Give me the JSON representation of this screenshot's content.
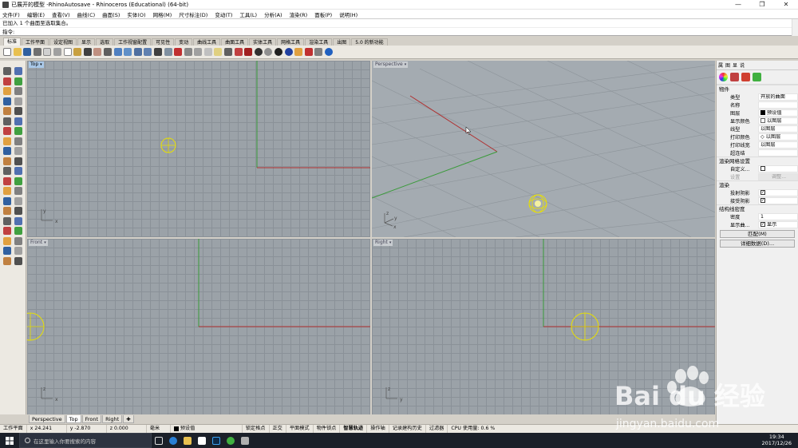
{
  "window": {
    "title": "已展开的模型 -RhinoAutosave - Rhinoceros (Educational) (64-bit)",
    "min_glyph": "—",
    "max_glyph": "❐",
    "close_glyph": "✕"
  },
  "menu": [
    "文件(F)",
    "编辑(E)",
    "查看(V)",
    "曲线(C)",
    "曲面(S)",
    "实体(O)",
    "网格(M)",
    "尺寸标注(D)",
    "变动(T)",
    "工具(L)",
    "分析(A)",
    "渲染(R)",
    "面板(P)",
    "说明(H)"
  ],
  "command": {
    "history": "已加入 1 个曲面至选取集合。",
    "prompt": "指令:"
  },
  "toolbar_tabs": [
    "标准",
    "工作平面",
    "设定视图",
    "显示",
    "选取",
    "工作视窗配置",
    "可见性",
    "变动",
    "曲线工具",
    "曲面工具",
    "实体工具",
    "网格工具",
    "渲染工具",
    "出图",
    "5.0 的新功能"
  ],
  "viewports": {
    "top": {
      "label": "Top",
      "dd": "▾"
    },
    "perspective": {
      "label": "Perspective",
      "dd": "▾"
    },
    "front": {
      "label": "Front",
      "dd": "▾"
    },
    "right": {
      "label": "Right",
      "dd": "▾"
    },
    "axis_top": {
      "x": "x",
      "y": "y"
    },
    "axis_persp": {
      "x": "x",
      "y": "y",
      "z": "z"
    },
    "axis_front": {
      "x": "x",
      "z": "z"
    },
    "axis_right": {
      "y": "y",
      "z": "z"
    }
  },
  "viewport_tabs": [
    "Perspective",
    "Top",
    "Front",
    "Right"
  ],
  "viewport_tab_add": "✚",
  "panel": {
    "tabs": [
      "属",
      "图",
      "显",
      "说"
    ],
    "sections": {
      "object": "物件",
      "render_mesh": "渲染网格设置",
      "render": "渲染",
      "isocurve": "结构线密度"
    },
    "props": {
      "type_k": "类型",
      "type_v": "开放的曲面",
      "name_k": "名称",
      "name_v": "",
      "layer_k": "图层",
      "layer_v": "预设值",
      "color_k": "显示颜色",
      "color_v": "以图层",
      "linetype_k": "线型",
      "linetype_v": "以图层",
      "printcolor_k": "打印颜色",
      "printcolor_v": "◇ 以图层",
      "printwidth_k": "打印线宽",
      "printwidth_v": "以图层",
      "hyperlink_k": "超连结",
      "hyperlink_v": "",
      "custom_k": "自定义...",
      "settings_k": "设置",
      "settings_v": "调整...",
      "cast_k": "投射阴影",
      "receive_k": "接受阴影",
      "density_k": "密度",
      "density_v": "1",
      "showcurve_k": "显示曲...",
      "showcurve_v": "显示"
    },
    "match_button": "匹配(M)",
    "details_button": "详细数据(D)..."
  },
  "status": {
    "cplane": "工作平面",
    "x": "x 24.241",
    "y": "y -2.870",
    "z": "z 0.000",
    "unit": "毫米",
    "layer": "预设值",
    "items": [
      "锁定格点",
      "正交",
      "平面模式",
      "物件锁点",
      "智慧轨迹",
      "操作轴",
      "记录建构历史",
      "过滤器",
      "CPU 使用量: 0.6 %"
    ]
  },
  "taskbar": {
    "search_placeholder": "在这里输入你要搜索的内容",
    "time": "19:34",
    "date": "2017/12/26"
  },
  "watermark": {
    "text": "Bai du 经验",
    "url": "jingyan.baidu.com"
  },
  "colors": {
    "x_axis": "#b03030",
    "y_axis": "#3a9a3a",
    "selection": "#e8e000",
    "viewport_bg": "#9ba2a8"
  }
}
